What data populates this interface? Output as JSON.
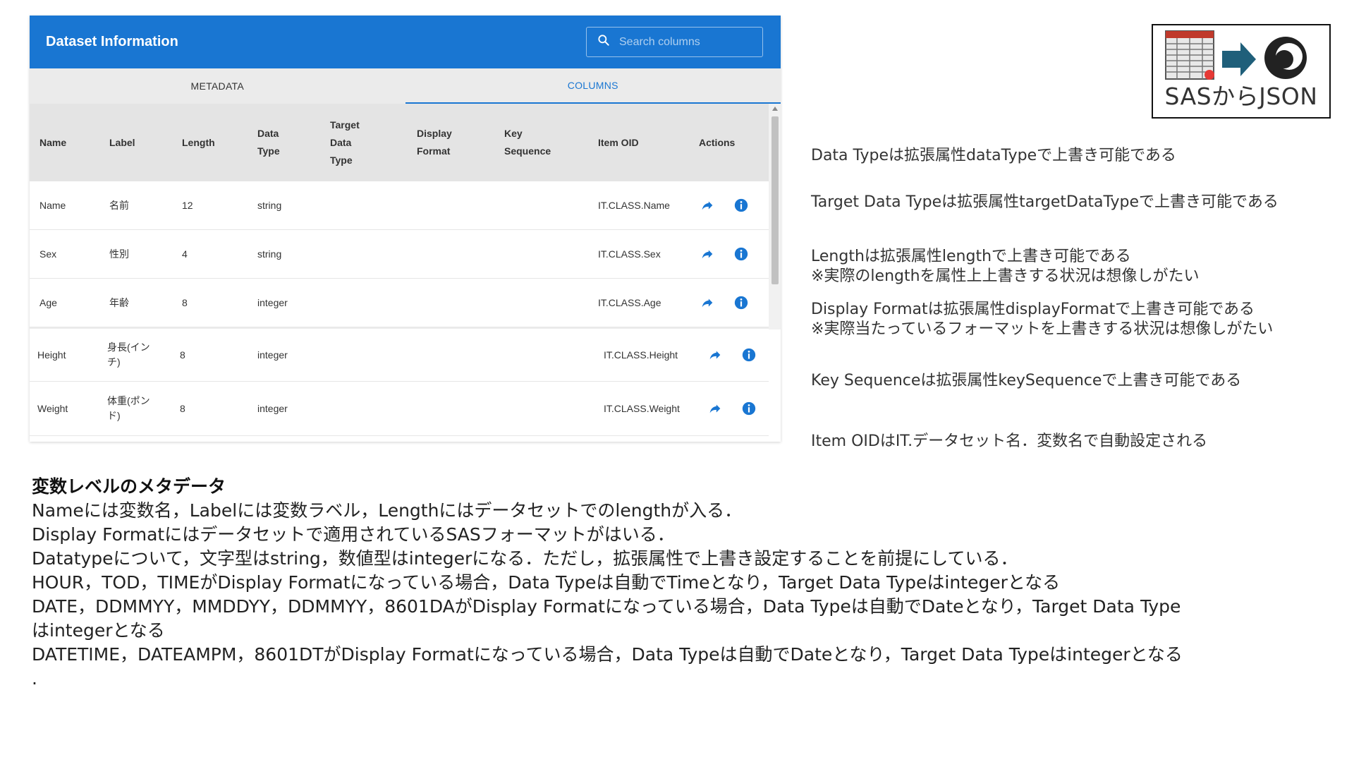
{
  "panel": {
    "title": "Dataset Information",
    "search_placeholder": "Search columns",
    "tabs": [
      {
        "label": "METADATA",
        "active": false
      },
      {
        "label": "COLUMNS",
        "active": true
      }
    ],
    "headers": [
      "Name",
      "Label",
      "Length",
      "Data Type",
      "Target Data Type",
      "Display Format",
      "Key Sequence",
      "Item OID",
      "Actions"
    ],
    "header_lines": {
      "name": [
        "Name"
      ],
      "label": [
        "Label"
      ],
      "length": [
        "Length"
      ],
      "data_type": [
        "Data",
        "Type"
      ],
      "target_data_type": [
        "Target",
        "Data",
        "Type"
      ],
      "display_format": [
        "Display",
        "Format"
      ],
      "key_sequence": [
        "Key",
        "Sequence"
      ],
      "item_oid": [
        "Item OID"
      ],
      "actions": [
        "Actions"
      ]
    },
    "rows": [
      {
        "name": "Name",
        "label": "名前",
        "length": "12",
        "data_type": "string",
        "target_data_type": "",
        "display_format": "",
        "key_sequence": "",
        "item_oid": "IT.CLASS.Name"
      },
      {
        "name": "Sex",
        "label": "性別",
        "length": "4",
        "data_type": "string",
        "target_data_type": "",
        "display_format": "",
        "key_sequence": "",
        "item_oid": "IT.CLASS.Sex"
      },
      {
        "name": "Age",
        "label": "年齢",
        "length": "8",
        "data_type": "integer",
        "target_data_type": "",
        "display_format": "",
        "key_sequence": "",
        "item_oid": "IT.CLASS.Age"
      }
    ],
    "rows2": [
      {
        "name": "Height",
        "label_lines": [
          "身長(イン",
          "チ)"
        ],
        "length": "8",
        "data_type": "integer",
        "item_oid": "IT.CLASS.Height"
      },
      {
        "name": "Weight",
        "label_lines": [
          "体重(ポン",
          "ド)"
        ],
        "length": "8",
        "data_type": "integer",
        "item_oid": "IT.CLASS.Weight"
      }
    ],
    "action_icons": [
      "share-arrow-icon",
      "info-icon"
    ],
    "colors": {
      "header_bg": "#1976d2",
      "accent": "#1976d2",
      "tabs_bg": "#ebebeb",
      "thead_bg": "#e4e4e4"
    }
  },
  "logo": {
    "text": "SASからJSON"
  },
  "notes": [
    "Data Typeは拡張属性dataTypeで上書き可能である",
    "Target Data Typeは拡張属性targetDataTypeで上書き可能である",
    "Lengthは拡張属性lengthで上書き可能である",
    "※実際のlengthを属性上上書きする状況は想像しがたい",
    "Display Formatは拡張属性displayFormatで上書き可能である",
    "※実際当たっているフォーマットを上書きする状況は想像しがたい",
    "Key Sequenceは拡張属性keySequenceで上書き可能である",
    "Item OIDはIT.データセット名．変数名で自動設定される"
  ],
  "description": {
    "title": "変数レベルのメタデータ",
    "lines": [
      "Nameには変数名，Labelには変数ラベル，Lengthにはデータセットでのlengthが入る．",
      "Display Formatにはデータセットで適用されているSASフォーマットがはいる．",
      "Datatypeについて，文字型はstring，数値型はintegerになる．ただし，拡張属性で上書き設定することを前提にしている．",
      "HOUR，TOD，TIMEがDisplay Formatになっている場合，Data Typeは自動でTimeとなり，Target Data Typeはintegerとなる",
      "DATE，DDMMYY，MMDDYY，DDMMYY，8601DAがDisplay Formatになっている場合，Data Typeは自動でDateとなり，Target Data Type",
      "はintegerとなる",
      "DATETIME，DATEAMPM，8601DTがDisplay Formatになっている場合，Data Typeは自動でDateとなり，Target Data Typeはintegerとなる",
      "."
    ]
  }
}
